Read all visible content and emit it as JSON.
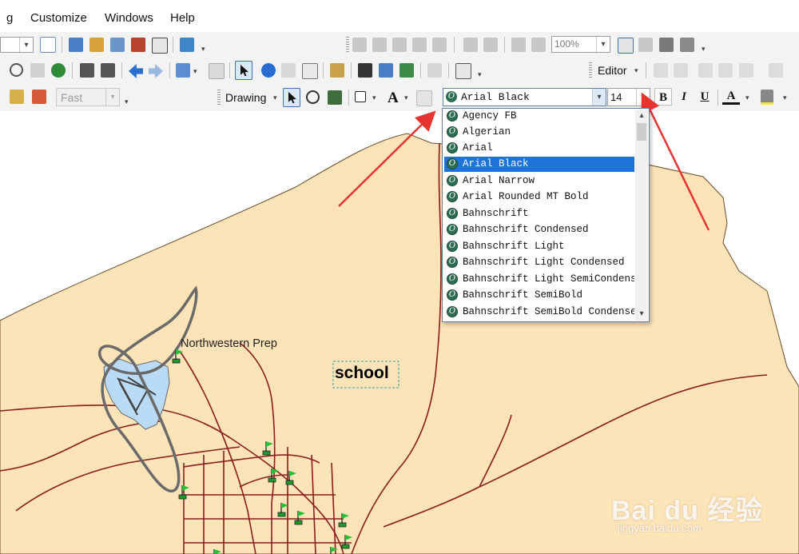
{
  "menubar": {
    "items": [
      {
        "label": "g"
      },
      {
        "label": "Customize"
      },
      {
        "label": "Windows"
      },
      {
        "label": "Help"
      }
    ]
  },
  "toolbar1": {
    "zoom_value": "100%"
  },
  "toolbar2": {
    "editor_label": "Editor"
  },
  "toolbar3": {
    "display_mode": "Fast",
    "drawing_label": "Drawing",
    "font_name": "Arial Black",
    "font_size": "14",
    "bold_label": "B",
    "italic_label": "I",
    "underline_label": "U",
    "font_color_label": "A",
    "text_tool_label": "A"
  },
  "font_dropdown": {
    "selected": "Arial Black",
    "items": [
      "Agency FB",
      "Algerian",
      "Arial",
      "Arial Black",
      "Arial Narrow",
      "Arial Rounded MT Bold",
      "Bahnschrift",
      "Bahnschrift Condensed",
      "Bahnschrift Light",
      "Bahnschrift Light Condensed",
      "Bahnschrift Light SemiCondensed",
      "Bahnschrift SemiBold",
      "Bahnschrift SemiBold Condensed"
    ]
  },
  "map": {
    "labels": {
      "poi": "Northwestern Prep",
      "inserted_text": "school"
    },
    "colors": {
      "land": "#fde3b8",
      "roads": "#8b1c1c",
      "water": "#b9dbf5",
      "outline": "#6a6a6a",
      "arrow": "#e8342f",
      "flag": "#22c23a"
    }
  },
  "watermark": {
    "brand": "Bai du 经验",
    "url": "jingyan.baidu.com"
  }
}
